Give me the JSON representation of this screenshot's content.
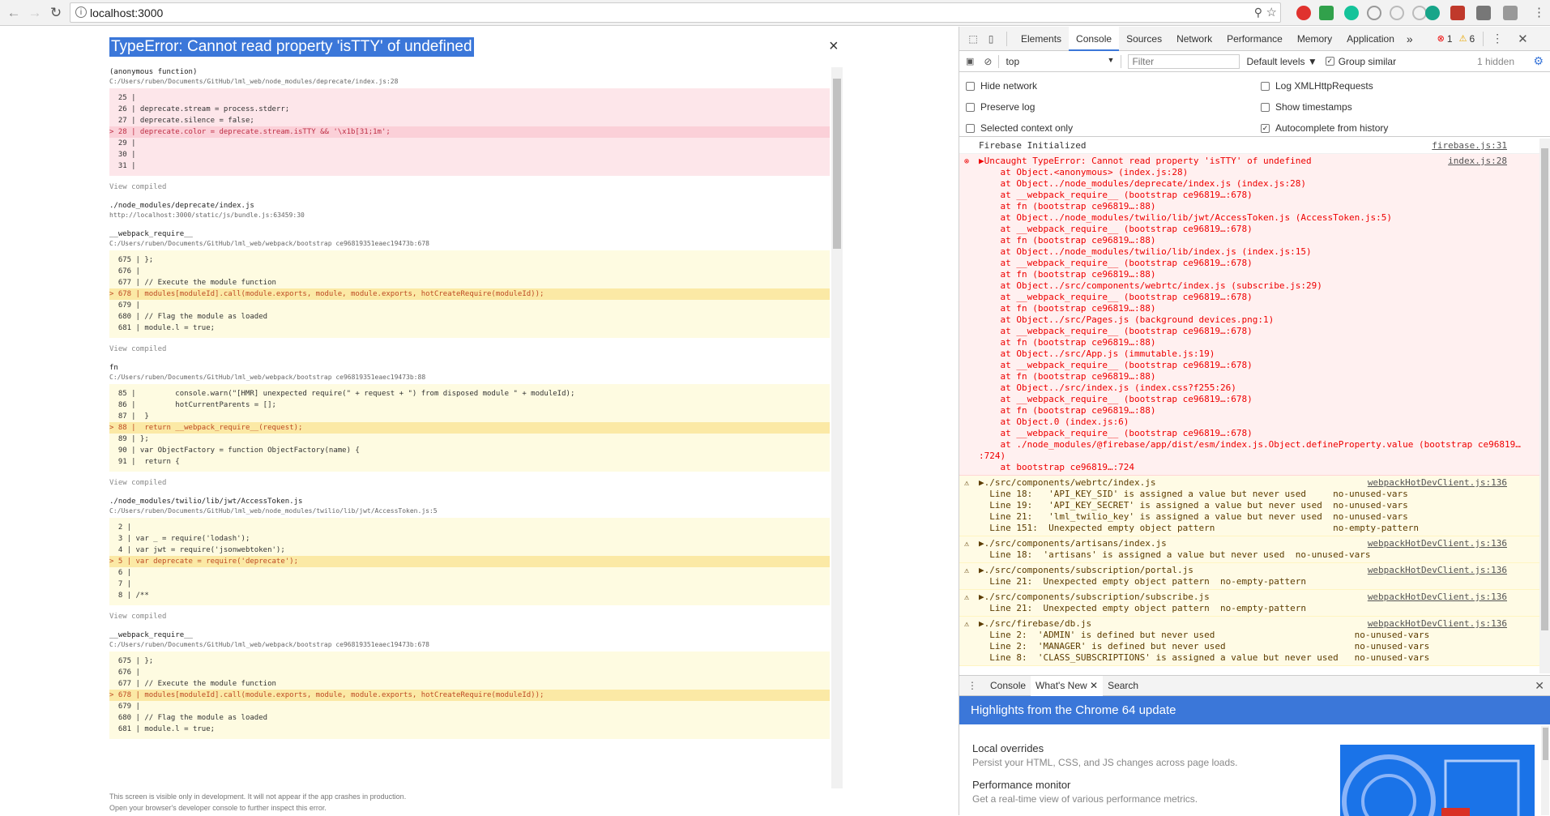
{
  "browser": {
    "url": "localhost:3000",
    "back_icon": "back-arrow-icon",
    "forward_icon": "forward-arrow-icon",
    "reload_icon": "reload-icon",
    "info_icon": "info-icon"
  },
  "overlay": {
    "title": "TypeError: Cannot read property 'isTTY' of undefined",
    "close": "×",
    "view_compiled": "View compiled",
    "footer_line1": "This screen is visible only in development. It will not appear if the app crashes in production.",
    "footer_line2": "Open your browser's developer console to further inspect this error.",
    "frames": [
      {
        "fn": "(anonymous function)",
        "path": "C:/Users/ruben/Documents/GitHub/lml_web/node_modules/deprecate/index.js:28",
        "style": "pink",
        "lines": [
          {
            "t": "  25 | ",
            "hl": false
          },
          {
            "t": "  26 | deprecate.stream = process.stderr;",
            "hl": false
          },
          {
            "t": "  27 | deprecate.silence = false;",
            "hl": false
          },
          {
            "t": "> 28 | deprecate.color = deprecate.stream.isTTY && '\\x1b[31;1m';",
            "hl": true
          },
          {
            "t": "  29 | ",
            "hl": false
          },
          {
            "t": "  30 | ",
            "hl": false
          },
          {
            "t": "  31 | ",
            "hl": false
          }
        ],
        "view_compiled": true
      },
      {
        "fn": "./node_modules/deprecate/index.js",
        "path": "http://localhost:3000/static/js/bundle.js:63459:30",
        "style": "none",
        "lines": [],
        "view_compiled": false
      },
      {
        "fn": "__webpack_require__",
        "path": "C:/Users/ruben/Documents/GitHub/lml_web/webpack/bootstrap ce96819351eaec19473b:678",
        "style": "yellow",
        "lines": [
          {
            "t": "  675 | };",
            "hl": false
          },
          {
            "t": "  676 | ",
            "hl": false
          },
          {
            "t": "  677 | // Execute the module function",
            "hl": false
          },
          {
            "t": "> 678 | modules[moduleId].call(module.exports, module, module.exports, hotCreateRequire(moduleId));",
            "hl": true
          },
          {
            "t": "  679 | ",
            "hl": false
          },
          {
            "t": "  680 | // Flag the module as loaded",
            "hl": false
          },
          {
            "t": "  681 | module.l = true;",
            "hl": false
          }
        ],
        "view_compiled": true
      },
      {
        "fn": "fn",
        "path": "C:/Users/ruben/Documents/GitHub/lml_web/webpack/bootstrap ce96819351eaec19473b:88",
        "style": "yellow",
        "lines": [
          {
            "t": "  85 |         console.warn(\"[HMR] unexpected require(\" + request + \") from disposed module \" + moduleId);",
            "hl": false
          },
          {
            "t": "  86 |         hotCurrentParents = [];",
            "hl": false
          },
          {
            "t": "  87 |  }",
            "hl": false
          },
          {
            "t": "> 88 |  return __webpack_require__(request);",
            "hl": true
          },
          {
            "t": "  89 | };",
            "hl": false
          },
          {
            "t": "  90 | var ObjectFactory = function ObjectFactory(name) {",
            "hl": false
          },
          {
            "t": "  91 |  return {",
            "hl": false
          }
        ],
        "view_compiled": true
      },
      {
        "fn": "./node_modules/twilio/lib/jwt/AccessToken.js",
        "path": "C:/Users/ruben/Documents/GitHub/lml_web/node_modules/twilio/lib/jwt/AccessToken.js:5",
        "style": "yellow",
        "lines": [
          {
            "t": "  2 | ",
            "hl": false
          },
          {
            "t": "  3 | var _ = require('lodash');",
            "hl": false
          },
          {
            "t": "  4 | var jwt = require('jsonwebtoken');",
            "hl": false
          },
          {
            "t": "> 5 | var deprecate = require('deprecate');",
            "hl": true
          },
          {
            "t": "  6 | ",
            "hl": false
          },
          {
            "t": "  7 | ",
            "hl": false
          },
          {
            "t": "  8 | /**",
            "hl": false
          }
        ],
        "view_compiled": true
      },
      {
        "fn": "__webpack_require__",
        "path": "C:/Users/ruben/Documents/GitHub/lml_web/webpack/bootstrap ce96819351eaec19473b:678",
        "style": "yellow",
        "lines": [
          {
            "t": "  675 | };",
            "hl": false
          },
          {
            "t": "  676 | ",
            "hl": false
          },
          {
            "t": "  677 | // Execute the module function",
            "hl": false
          },
          {
            "t": "> 678 | modules[moduleId].call(module.exports, module, module.exports, hotCreateRequire(moduleId));",
            "hl": true
          },
          {
            "t": "  679 | ",
            "hl": false
          },
          {
            "t": "  680 | // Flag the module as loaded",
            "hl": false
          },
          {
            "t": "  681 | module.l = true;",
            "hl": false
          }
        ],
        "view_compiled": false
      }
    ]
  },
  "devtools": {
    "tabs": [
      "Elements",
      "Console",
      "Sources",
      "Network",
      "Performance",
      "Memory",
      "Application"
    ],
    "active_tab": "Console",
    "more": "»",
    "error_count": "1",
    "warning_count": "6",
    "context": "top",
    "filter_placeholder": "Filter",
    "levels": "Default levels ▼",
    "group_similar": "Group similar",
    "hidden": "1 hidden",
    "settings": {
      "hide_network": "Hide network",
      "preserve_log": "Preserve log",
      "selected_context": "Selected context only",
      "log_xhr": "Log XMLHttpRequests",
      "show_timestamps": "Show timestamps",
      "autocomplete": "Autocomplete from history"
    },
    "messages": [
      {
        "type": "log",
        "text": "Firebase Initialized",
        "src": "firebase.js:31"
      },
      {
        "type": "err",
        "text": "▶Uncaught TypeError: Cannot read property 'isTTY' of undefined\n    at Object.<anonymous> (index.js:28)\n    at Object../node_modules/deprecate/index.js (index.js:28)\n    at __webpack_require__ (bootstrap ce96819…:678)\n    at fn (bootstrap ce96819…:88)\n    at Object../node_modules/twilio/lib/jwt/AccessToken.js (AccessToken.js:5)\n    at __webpack_require__ (bootstrap ce96819…:678)\n    at fn (bootstrap ce96819…:88)\n    at Object../node_modules/twilio/lib/index.js (index.js:15)\n    at __webpack_require__ (bootstrap ce96819…:678)\n    at fn (bootstrap ce96819…:88)\n    at Object../src/components/webrtc/index.js (subscribe.js:29)\n    at __webpack_require__ (bootstrap ce96819…:678)\n    at fn (bootstrap ce96819…:88)\n    at Object../src/Pages.js (background devices.png:1)\n    at __webpack_require__ (bootstrap ce96819…:678)\n    at fn (bootstrap ce96819…:88)\n    at Object../src/App.js (immutable.js:19)\n    at __webpack_require__ (bootstrap ce96819…:678)\n    at fn (bootstrap ce96819…:88)\n    at Object../src/index.js (index.css?f255:26)\n    at __webpack_require__ (bootstrap ce96819…:678)\n    at fn (bootstrap ce96819…:88)\n    at Object.0 (index.js:6)\n    at __webpack_require__ (bootstrap ce96819…:678)\n    at ./node_modules/@firebase/app/dist/esm/index.js.Object.defineProperty.value (bootstrap ce96819…\n:724)\n    at bootstrap ce96819…:724",
        "src": "index.js:28"
      },
      {
        "type": "warn",
        "text": "▶./src/components/webrtc/index.js\n  Line 18:   'API_KEY_SID' is assigned a value but never used     no-unused-vars\n  Line 19:   'API_KEY_SECRET' is assigned a value but never used  no-unused-vars\n  Line 21:   'lml_twilio_key' is assigned a value but never used  no-unused-vars\n  Line 151:  Unexpected empty object pattern                      no-empty-pattern",
        "src": "webpackHotDevClient.js:136"
      },
      {
        "type": "warn",
        "text": "▶./src/components/artisans/index.js\n  Line 18:  'artisans' is assigned a value but never used  no-unused-vars",
        "src": "webpackHotDevClient.js:136"
      },
      {
        "type": "warn",
        "text": "▶./src/components/subscription/portal.js\n  Line 21:  Unexpected empty object pattern  no-empty-pattern",
        "src": "webpackHotDevClient.js:136"
      },
      {
        "type": "warn",
        "text": "▶./src/components/subscription/subscribe.js\n  Line 21:  Unexpected empty object pattern  no-empty-pattern",
        "src": "webpackHotDevClient.js:136"
      },
      {
        "type": "warn",
        "text": "▶./src/firebase/db.js\n  Line 2:  'ADMIN' is defined but never used                          no-unused-vars\n  Line 2:  'MANAGER' is defined but never used                        no-unused-vars\n  Line 8:  'CLASS_SUBSCRIPTIONS' is assigned a value but never used   no-unused-vars",
        "src": "webpackHotDevClient.js:136"
      }
    ],
    "drawer": {
      "tabs": [
        "Console",
        "What's New",
        "Search"
      ],
      "active": "What's New",
      "banner": "Highlights from the Chrome 64 update",
      "features": [
        {
          "title": "Local overrides",
          "desc": "Persist your HTML, CSS, and JS changes across page loads."
        },
        {
          "title": "Performance monitor",
          "desc": "Get a real-time view of various performance metrics."
        }
      ]
    }
  }
}
